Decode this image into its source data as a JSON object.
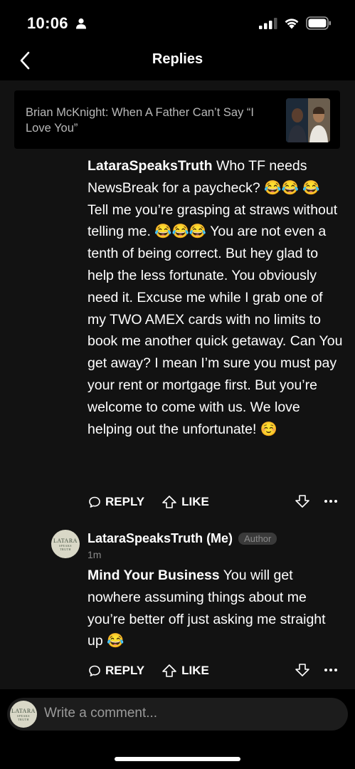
{
  "status_bar": {
    "time": "10:06"
  },
  "nav": {
    "title": "Replies"
  },
  "article": {
    "title": "Brian McKnight: When A Father Can’t Say “I Love You”"
  },
  "comment1": {
    "author": "LataraSpeaksTruth",
    "text": " Who TF needs NewsBreak for a paycheck? 😂😂 😂 Tell me you’re grasping at straws without telling me. 😂😂😂 You are not even a tenth of being correct. But hey glad to help the less fortunate. You obviously need it. Excuse me while I grab one of my TWO AMEX cards with no limits to book me another quick getaway. Can You get away? I mean I’m sure you must pay your rent or mortgage first. But you’re welcome to come with us. We love helping out the unfortunate! ☺️",
    "reply_label": "REPLY",
    "like_label": "LIKE"
  },
  "comment2": {
    "author": "LataraSpeaksTruth (Me)",
    "badge": "Author",
    "time": "1m",
    "mention": "Mind Your Business",
    "text": " You will get nowhere assuming things about me you’re better off just asking me straight up 😂",
    "reply_label": "REPLY",
    "like_label": "LIKE"
  },
  "avatar": {
    "line1": "LATARA",
    "line2": "SPEAKS",
    "line3": "TRUTH"
  },
  "composer": {
    "placeholder": "Write a comment..."
  },
  "colors": {
    "background": "#000000",
    "panel": "#121212",
    "muted": "#8a8a8a",
    "avatar": "#d9d8c7"
  }
}
